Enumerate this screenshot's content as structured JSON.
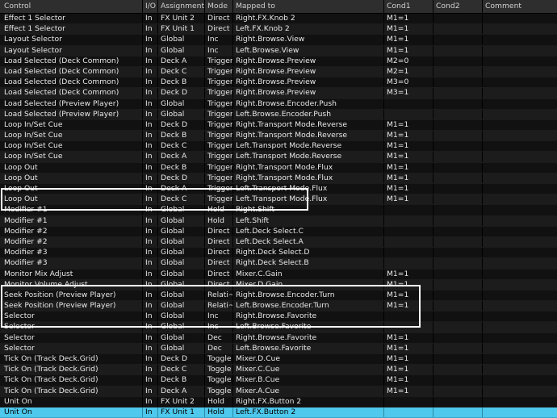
{
  "columns": [
    "Control",
    "I/O",
    "Assignment",
    "Mode",
    "Mapped to",
    "Cond1",
    "Cond2",
    "Comment"
  ],
  "rows": [
    [
      "Effect 1 Selector",
      "In",
      "FX Unit 2",
      "Direct",
      "Right.FX.Knob 2",
      "M1=1",
      "",
      ""
    ],
    [
      "Effect 1 Selector",
      "In",
      "FX Unit 1",
      "Direct",
      "Left.FX.Knob 2",
      "M1=1",
      "",
      ""
    ],
    [
      "Layout Selector",
      "In",
      "Global",
      "Inc",
      "Right.Browse.View",
      "M1=1",
      "",
      ""
    ],
    [
      "Layout Selector",
      "In",
      "Global",
      "Inc",
      "Left.Browse.View",
      "M1=1",
      "",
      ""
    ],
    [
      "Load Selected (Deck Common)",
      "In",
      "Deck A",
      "Trigger",
      "Right.Browse.Preview",
      "M2=0",
      "",
      ""
    ],
    [
      "Load Selected (Deck Common)",
      "In",
      "Deck C",
      "Trigger",
      "Right.Browse.Preview",
      "M2=1",
      "",
      ""
    ],
    [
      "Load Selected (Deck Common)",
      "In",
      "Deck B",
      "Trigger",
      "Right.Browse.Preview",
      "M3=0",
      "",
      ""
    ],
    [
      "Load Selected (Deck Common)",
      "In",
      "Deck D",
      "Trigger",
      "Right.Browse.Preview",
      "M3=1",
      "",
      ""
    ],
    [
      "Load Selected (Preview Player)",
      "In",
      "Global",
      "Trigger",
      "Right.Browse.Encoder.Push",
      "",
      "",
      ""
    ],
    [
      "Load Selected (Preview Player)",
      "In",
      "Global",
      "Trigger",
      "Left.Browse.Encoder.Push",
      "",
      "",
      ""
    ],
    [
      "Loop In/Set Cue",
      "In",
      "Deck D",
      "Trigger",
      "Right.Transport Mode.Reverse",
      "M1=1",
      "",
      ""
    ],
    [
      "Loop In/Set Cue",
      "In",
      "Deck B",
      "Trigger",
      "Right.Transport Mode.Reverse",
      "M1=1",
      "",
      ""
    ],
    [
      "Loop In/Set Cue",
      "In",
      "Deck C",
      "Trigger",
      "Left.Transport Mode.Reverse",
      "M1=1",
      "",
      ""
    ],
    [
      "Loop In/Set Cue",
      "In",
      "Deck A",
      "Trigger",
      "Left.Transport Mode.Reverse",
      "M1=1",
      "",
      ""
    ],
    [
      "Loop Out",
      "In",
      "Deck B",
      "Trigger",
      "Right.Transport Mode.Flux",
      "M1=1",
      "",
      ""
    ],
    [
      "Loop Out",
      "In",
      "Deck D",
      "Trigger",
      "Right.Transport Mode.Flux",
      "M1=1",
      "",
      ""
    ],
    [
      "Loop Out",
      "In",
      "Deck A",
      "Trigger",
      "Left.Transport Mode.Flux",
      "M1=1",
      "",
      ""
    ],
    [
      "Loop Out",
      "In",
      "Deck C",
      "Trigger",
      "Left.Transport Mode.Flux",
      "M1=1",
      "",
      ""
    ],
    [
      "Modifier #1",
      "In",
      "Global",
      "Hold",
      "Right.Shift",
      "",
      "",
      ""
    ],
    [
      "Modifier #1",
      "In",
      "Global",
      "Hold",
      "Left.Shift",
      "",
      "",
      ""
    ],
    [
      "Modifier #2",
      "In",
      "Global",
      "Direct",
      "Left.Deck Select.C",
      "",
      "",
      ""
    ],
    [
      "Modifier #2",
      "In",
      "Global",
      "Direct",
      "Left.Deck Select.A",
      "",
      "",
      ""
    ],
    [
      "Modifier #3",
      "In",
      "Global",
      "Direct",
      "Right.Deck Select.D",
      "",
      "",
      ""
    ],
    [
      "Modifier #3",
      "In",
      "Global",
      "Direct",
      "Right.Deck Select.B",
      "",
      "",
      ""
    ],
    [
      "Monitor Mix Adjust",
      "In",
      "Global",
      "Direct",
      "Mixer.C.Gain",
      "M1=1",
      "",
      ""
    ],
    [
      "Monitor Volume Adjust",
      "In",
      "Global",
      "Direct",
      "Mixer.D.Gain",
      "M1=1",
      "",
      ""
    ],
    [
      "Seek Position (Preview Player)",
      "In",
      "Global",
      "Relati~",
      "Right.Browse.Encoder.Turn",
      "M1=1",
      "",
      ""
    ],
    [
      "Seek Position (Preview Player)",
      "In",
      "Global",
      "Relati~",
      "Left.Browse.Encoder.Turn",
      "M1=1",
      "",
      ""
    ],
    [
      "Selector",
      "In",
      "Global",
      "Inc",
      "Right.Browse.Favorite",
      "",
      "",
      ""
    ],
    [
      "Selector",
      "In",
      "Global",
      "Inc",
      "Left.Browse.Favorite",
      "",
      "",
      ""
    ],
    [
      "Selector",
      "In",
      "Global",
      "Dec",
      "Right.Browse.Favorite",
      "M1=1",
      "",
      ""
    ],
    [
      "Selector",
      "In",
      "Global",
      "Dec",
      "Left.Browse.Favorite",
      "M1=1",
      "",
      ""
    ],
    [
      "Tick On (Track Deck.Grid)",
      "In",
      "Deck D",
      "Toggle",
      "Mixer.D.Cue",
      "M1=1",
      "",
      ""
    ],
    [
      "Tick On (Track Deck.Grid)",
      "In",
      "Deck C",
      "Toggle",
      "Mixer.C.Cue",
      "M1=1",
      "",
      ""
    ],
    [
      "Tick On (Track Deck.Grid)",
      "In",
      "Deck B",
      "Toggle",
      "Mixer.B.Cue",
      "M1=1",
      "",
      ""
    ],
    [
      "Tick On (Track Deck.Grid)",
      "In",
      "Deck A",
      "Toggle",
      "Mixer.A.Cue",
      "M1=1",
      "",
      ""
    ],
    [
      "Unit On",
      "In",
      "FX Unit 2",
      "Hold",
      "Right.FX.Button 2",
      "",
      "",
      ""
    ],
    [
      "Unit On",
      "In",
      "FX Unit 1",
      "Hold",
      "Left.FX.Button 2",
      "",
      "",
      ""
    ]
  ],
  "selected_row": 37,
  "colors": {
    "selected": "#4ec8ec",
    "highlight_box": "#ffffff"
  }
}
